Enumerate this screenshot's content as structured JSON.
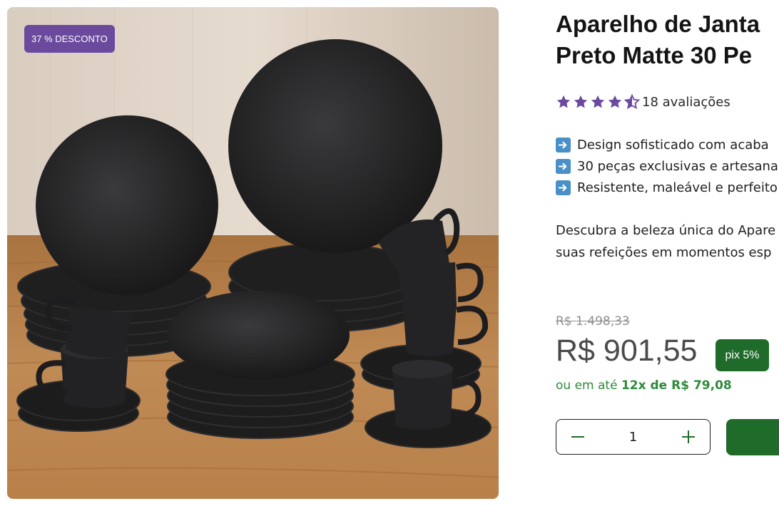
{
  "product": {
    "discount_badge": "37 % DESCONTO",
    "title_line1": "Aparelho de Janta",
    "title_line2": "Preto Matte 30 Pe",
    "rating": 4.5,
    "reviews": "18 avaliações",
    "features": [
      "Design sofisticado com acaba",
      "30 peças exclusivas e artesana",
      "Resistente, maleável e perfeito"
    ],
    "description_line1": "Descubra a beleza única do Apare",
    "description_line2": "suas refeições em momentos esp",
    "old_price": "R$ 1.498,33",
    "price": "R$ 901,55",
    "pix_badge": "pix 5%",
    "installments_prefix": "ou em até",
    "installments_value": "12x de R$ 79,08",
    "quantity": "1"
  },
  "colors": {
    "accent_purple": "#6b4a9e",
    "star": "#6b4a9e",
    "brand_green": "#1f6b2a",
    "installments_green": "#2f8a3b"
  },
  "icons": {
    "feature_bullet": "right-arrow-icon",
    "decrease": "minus-icon",
    "increase": "plus-icon"
  }
}
